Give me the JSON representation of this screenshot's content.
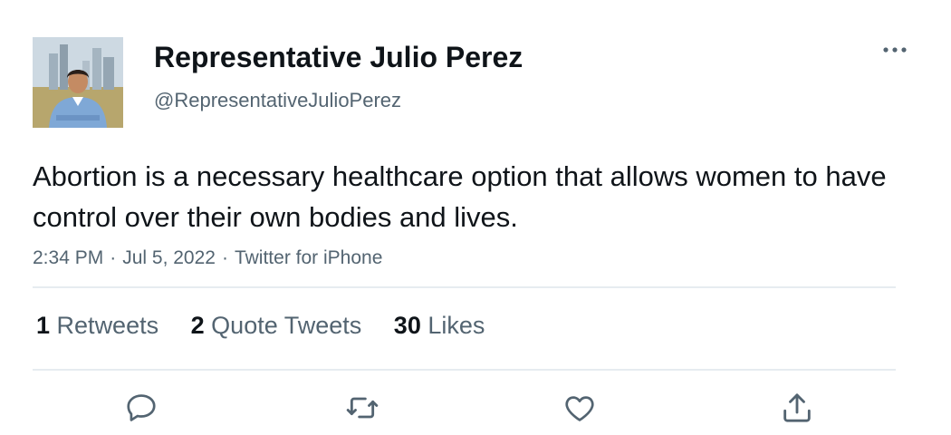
{
  "author": {
    "display_name": "Representative Julio Perez",
    "handle": "@RepresentativeJulioPerez",
    "avatar_icon": "profile-photo"
  },
  "tweet": {
    "text": "Abortion is a necessary healthcare option that allows women to have control over their own bodies and lives.",
    "time": "2:34 PM",
    "date": "Jul 5, 2022",
    "source": "Twitter for iPhone",
    "separator": "·"
  },
  "stats": {
    "retweets": {
      "count": "1",
      "label": "Retweets"
    },
    "quote_tweets": {
      "count": "2",
      "label": "Quote Tweets"
    },
    "likes": {
      "count": "30",
      "label": "Likes"
    }
  },
  "actions": [
    {
      "name": "reply",
      "icon": "reply-icon"
    },
    {
      "name": "retweet",
      "icon": "retweet-icon"
    },
    {
      "name": "like",
      "icon": "heart-icon"
    },
    {
      "name": "share",
      "icon": "share-icon"
    }
  ],
  "colors": {
    "text_primary": "#0f1419",
    "text_secondary": "#536471",
    "divider": "#e6ecf0"
  }
}
